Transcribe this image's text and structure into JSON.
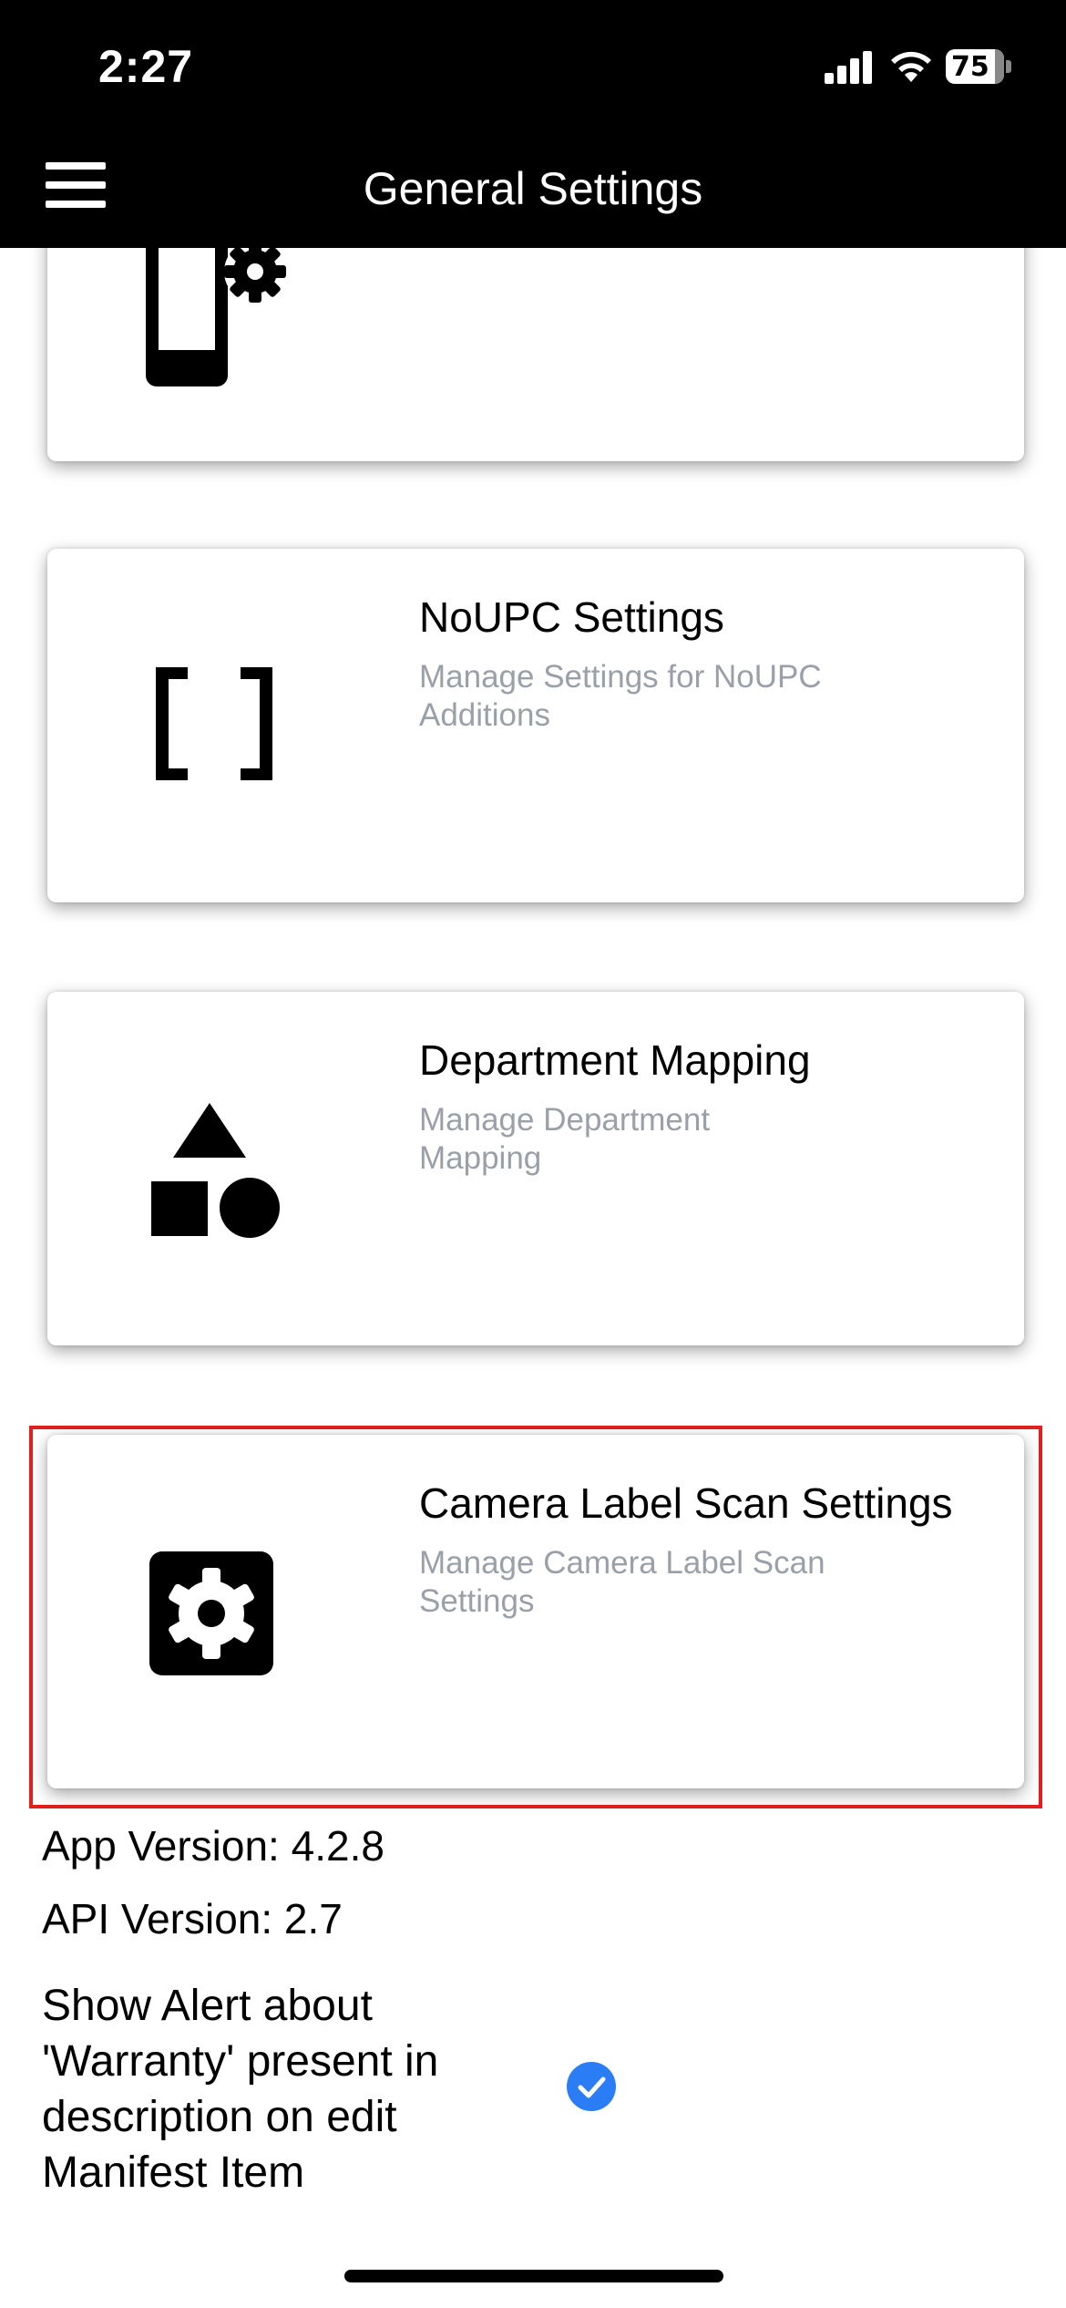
{
  "status_bar": {
    "time": "2:27",
    "battery": "75"
  },
  "header": {
    "title": "General Settings",
    "menu_icon": "hamburger-icon"
  },
  "cards": [
    {
      "title": "",
      "subtitle": "",
      "icon": "device-settings-icon"
    },
    {
      "title": "NoUPC Settings",
      "subtitle": "Manage Settings for NoUPC Additions",
      "icon": "brackets-icon"
    },
    {
      "title": "Department Mapping",
      "subtitle": "Manage Department Mapping",
      "icon": "shapes-icon"
    },
    {
      "title": "Camera Label Scan Settings",
      "subtitle": "Manage Camera Label Scan Settings",
      "icon": "gear-icon"
    }
  ],
  "info": {
    "app_version": "App Version: 4.2.8",
    "api_version": "API Version: 2.7"
  },
  "warranty_alert": {
    "label": "Show Alert about 'Warranty' present in description on edit Manifest Item",
    "checked": true
  },
  "colors": {
    "accent": "#2a7df4",
    "highlight": "#e02020",
    "header_bg": "#000000"
  }
}
